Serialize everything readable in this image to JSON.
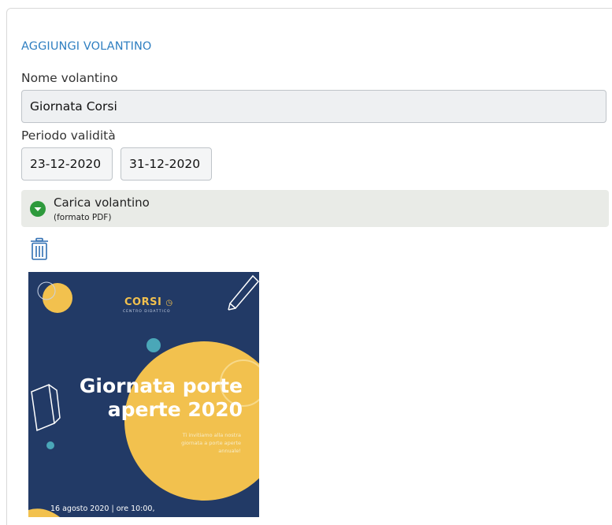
{
  "form": {
    "section_title": "AGGIUNGI VOLANTINO",
    "name_label": "Nome volantino",
    "name_value": "Giornata Corsi",
    "period_label": "Periodo validità",
    "date_from": "23-12-2020",
    "date_to": "31-12-2020"
  },
  "upload": {
    "title": "Carica volantino",
    "subtitle": "(formato PDF)",
    "icon": "chevron-down-circle-icon",
    "icon_color": "#2e9a3c"
  },
  "actions": {
    "delete_icon": "trash-icon"
  },
  "flyer": {
    "brand": "CORSI",
    "brand_sub": "CENTRO DIDATTICO",
    "headline_line1": "Giornata porte",
    "headline_line2": "aperte 2020",
    "invite_line1": "Ti invitiamo alla nostra",
    "invite_line2": "giornata a porte aperte",
    "invite_line3": "annuale!",
    "date": "16 agosto 2020 | ore 10:00,",
    "colors": {
      "background": "#223a66",
      "accent_yellow": "#f2c14e",
      "accent_teal": "#4aa7b8"
    }
  },
  "colors": {
    "title_blue": "#2f7fc1",
    "field_bg": "#eef0f2",
    "upload_bar_bg": "#e9ebe7"
  }
}
